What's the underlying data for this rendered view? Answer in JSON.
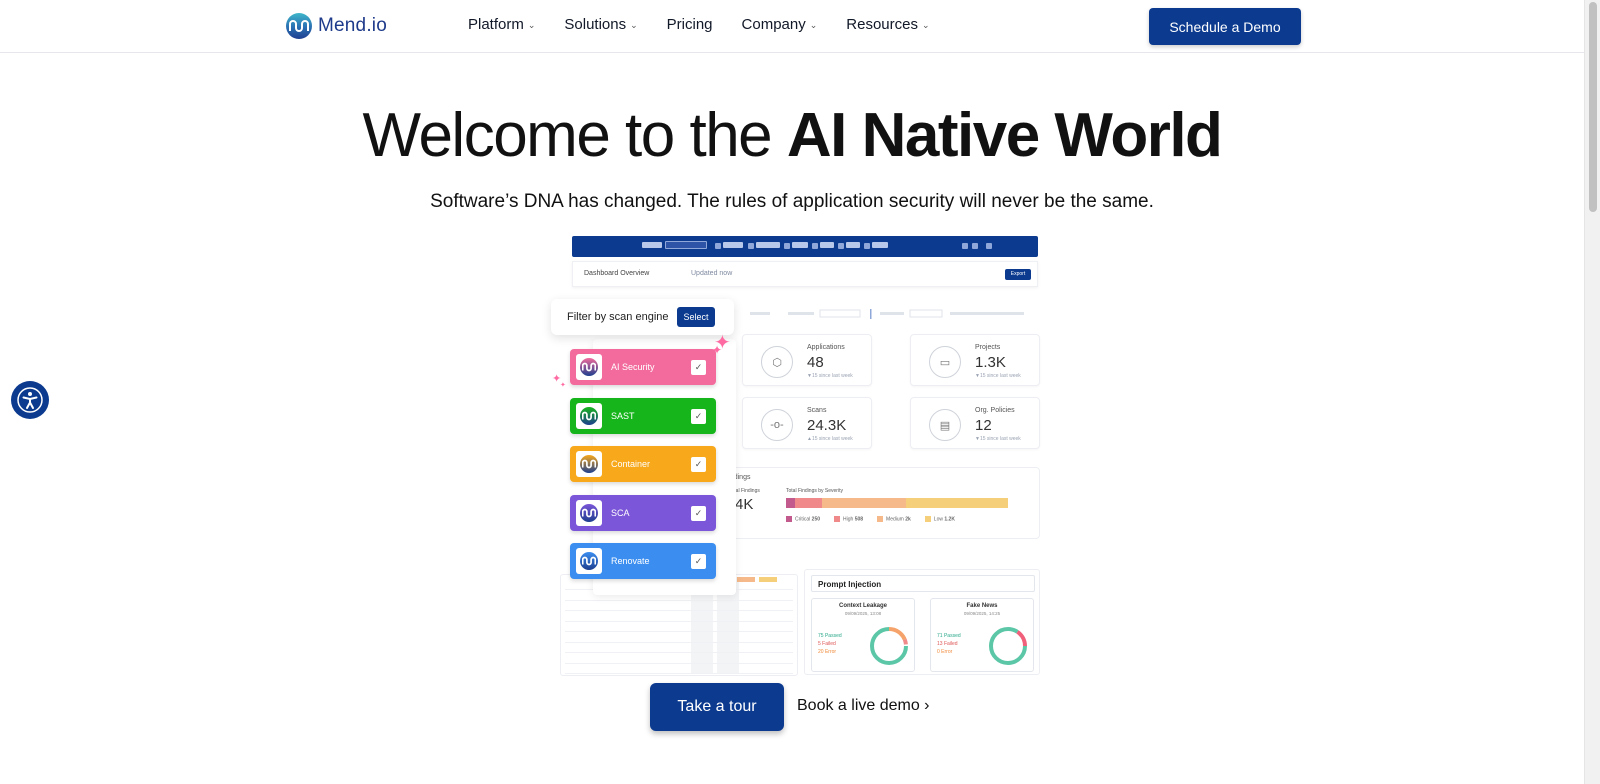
{
  "header": {
    "logo_text": "Mend.io",
    "nav": [
      {
        "label": "Platform",
        "has_dropdown": true
      },
      {
        "label": "Solutions",
        "has_dropdown": true
      },
      {
        "label": "Pricing",
        "has_dropdown": false
      },
      {
        "label": "Company",
        "has_dropdown": true
      },
      {
        "label": "Resources",
        "has_dropdown": true
      }
    ],
    "cta": "Schedule a Demo"
  },
  "hero": {
    "title_light": "Welcome to the ",
    "title_bold": "AI Native World",
    "subtitle": "Software’s DNA has changed. The rules of application security will never be the same."
  },
  "dashboard": {
    "overview_title": "Dashboard Overview",
    "updated": "Updated now",
    "export": "Export",
    "stats": [
      {
        "label": "Applications",
        "value": "48",
        "change": "▼15 since last week",
        "icon": "cube-icon"
      },
      {
        "label": "Projects",
        "value": "1.3K",
        "change": "▼15 since last week",
        "icon": "folder-icon"
      },
      {
        "label": "Scans",
        "value": "24.3K",
        "change": "▲15 since last week",
        "icon": "commit-icon"
      },
      {
        "label": "Org. Policies",
        "value": "12",
        "change": "▼15 since last week",
        "icon": "clipboard-icon"
      }
    ],
    "findings": {
      "title": "Findings",
      "total_label": "Total Findings",
      "total_value": "4K",
      "severity_label": "Total Findings by Severity",
      "severity": [
        {
          "name": "Critical",
          "value": "250",
          "color": "#c25a8e",
          "share": 0.04
        },
        {
          "name": "High",
          "value": "508",
          "color": "#f08a8a",
          "share": 0.12
        },
        {
          "name": "Medium",
          "value": "2k",
          "color": "#f5b98a",
          "share": 0.38
        },
        {
          "name": "Low",
          "value": "1.2K",
          "color": "#f5cf7a",
          "share": 0.46
        }
      ]
    },
    "prompt_injection": {
      "title": "Prompt Injection",
      "cards": [
        {
          "title": "Context Leakage",
          "date": "09/09/2025, 13:08",
          "passed": "75",
          "failed": "5",
          "error": "20"
        },
        {
          "title": "Fake News",
          "date": "09/09/2025, 14:25",
          "passed": "71",
          "failed": "13",
          "error": "0"
        }
      ],
      "labels": {
        "passed": "Passed",
        "failed": "Failed",
        "error": "Error"
      }
    },
    "filter": {
      "label": "Filter by scan engine",
      "button": "Select",
      "engines": [
        {
          "label": "AI Security",
          "color": "#f26b9c"
        },
        {
          "label": "SAST",
          "color": "#16b51c"
        },
        {
          "label": "Container",
          "color": "#f7a81b"
        },
        {
          "label": "SCA",
          "color": "#7b56d8"
        },
        {
          "label": "Renovate",
          "color": "#3b8ef0"
        }
      ]
    }
  },
  "ctas": {
    "tour": "Take a tour",
    "live": "Book a live demo ›"
  },
  "colors": {
    "brand": "#0b3a8f"
  }
}
